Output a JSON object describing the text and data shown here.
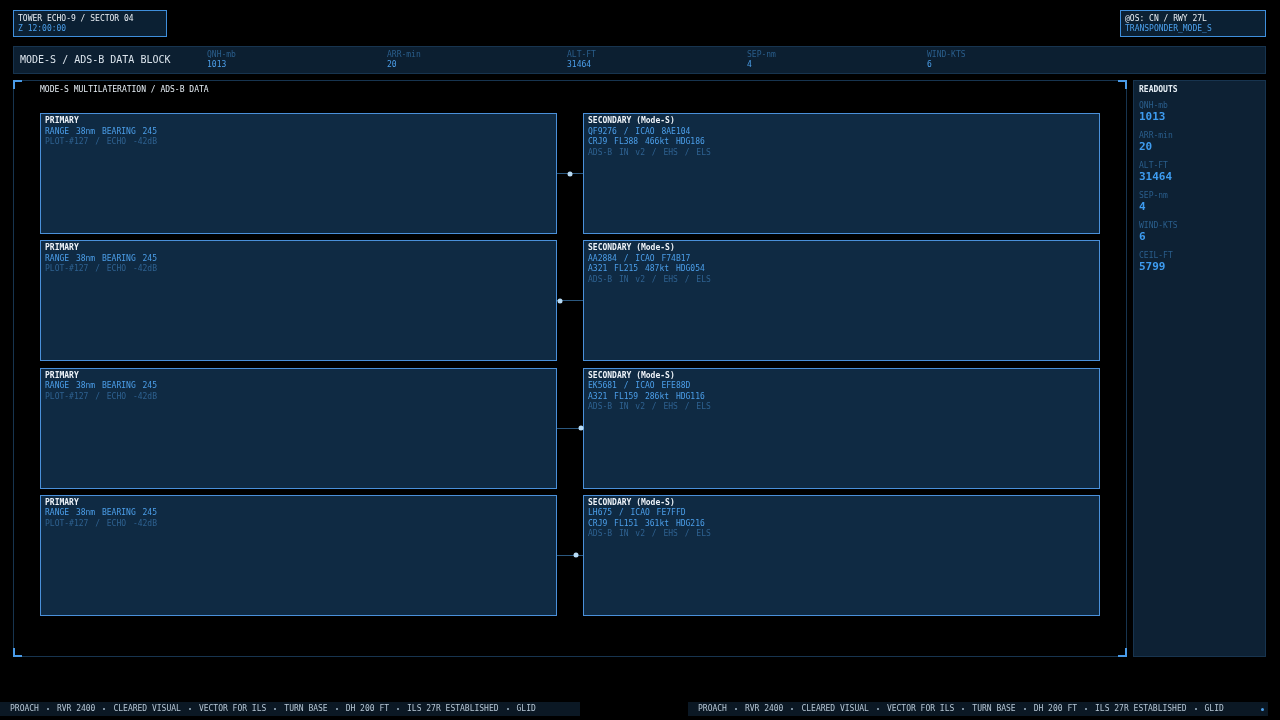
{
  "station": {
    "title": "TOWER ECHO-9 / SECTOR 04",
    "time": "Z 12:00:00"
  },
  "status": {
    "title": "@OS: CN / RWY 27L",
    "mode": "TRANSPONDER_MODE_S"
  },
  "header": {
    "title": "MODE-S / ADS-B DATA BLOCK",
    "metrics": [
      {
        "label": "QNH-mb",
        "value": "1013"
      },
      {
        "label": "ARR-min",
        "value": "20"
      },
      {
        "label": "ALT-FT",
        "value": "31464"
      },
      {
        "label": "SEP-nm",
        "value": "4"
      },
      {
        "label": "WIND-KTS",
        "value": "6"
      }
    ]
  },
  "panel": {
    "title": "MODE-S MULTILATERATION / ADS-B DATA",
    "rows": [
      {
        "primary": {
          "heading": "PRIMARY",
          "range": "RANGE 38nm BEARING 245",
          "plot": "PLOT-#127 / ECHO -42dB"
        },
        "link": {
          "level": 0.5
        },
        "secondary": {
          "heading": "SECONDARY (Mode-S)",
          "ident": "QF9276 / ICAO 8AE104",
          "flight": "CRJ9 FL388 466kt HDG186",
          "caps": "ADS-B IN v2 / EHS / ELS"
        }
      },
      {
        "primary": {
          "heading": "PRIMARY",
          "range": "RANGE 38nm BEARING 245",
          "plot": "PLOT-#127 / ECHO -42dB"
        },
        "link": {
          "level": 0.12
        },
        "secondary": {
          "heading": "SECONDARY (Mode-S)",
          "ident": "AA2884 / ICAO F74B17",
          "flight": "A321 FL215 487kt HDG054",
          "caps": "ADS-B IN v2 / EHS / ELS"
        }
      },
      {
        "primary": {
          "heading": "PRIMARY",
          "range": "RANGE 38nm BEARING 245",
          "plot": "PLOT-#127 / ECHO -42dB"
        },
        "link": {
          "level": 0.93
        },
        "secondary": {
          "heading": "SECONDARY (Mode-S)",
          "ident": "EK5681 / ICAO EFE88D",
          "flight": "A321 FL159 286kt HDG116",
          "caps": "ADS-B IN v2 / EHS / ELS"
        }
      },
      {
        "primary": {
          "heading": "PRIMARY",
          "range": "RANGE 38nm BEARING 245",
          "plot": "PLOT-#127 / ECHO -42dB"
        },
        "link": {
          "level": 0.74
        },
        "secondary": {
          "heading": "SECONDARY (Mode-S)",
          "ident": "LH675 / ICAO FE7FFD",
          "flight": "CRJ9 FL151 361kt HDG216",
          "caps": "ADS-B IN v2 / EHS / ELS"
        }
      }
    ]
  },
  "readouts": {
    "title": "READOUTS",
    "items": [
      {
        "label": "QNH-mb",
        "value": "1013"
      },
      {
        "label": "ARR-min",
        "value": "20"
      },
      {
        "label": "ALT-FT",
        "value": "31464"
      },
      {
        "label": "SEP-nm",
        "value": "4"
      },
      {
        "label": "WIND-KTS",
        "value": "6"
      },
      {
        "label": "CEIL-FT",
        "value": "5799"
      }
    ]
  },
  "tickers": [
    {
      "items": [
        "PROACH",
        "RVR 2400",
        "CLEARED VISUAL",
        "VECTOR FOR ILS",
        "TURN BASE",
        "DH 200 FT",
        "ILS 27R ESTABLISHED",
        "GLID"
      ],
      "indicator": false
    },
    {
      "items": [
        "PROACH",
        "RVR 2400",
        "CLEARED VISUAL",
        "VECTOR FOR ILS",
        "TURN BASE",
        "DH 200 FT",
        "ILS 27R ESTABLISHED",
        "GLID"
      ],
      "indicator": true
    }
  ]
}
